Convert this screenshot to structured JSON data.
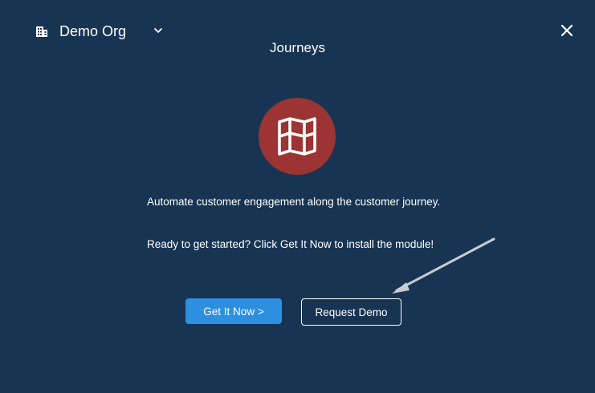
{
  "header": {
    "org_name": "Demo Org",
    "org_icon": "building-icon",
    "chevron_icon": "chevron-down-icon",
    "close_icon": "close-icon"
  },
  "module": {
    "title": "Journeys",
    "icon": "map-icon",
    "icon_bg_color": "#9b3432",
    "description": "Automate customer engagement along the customer journey.",
    "cta_text": "Ready to get started? Click Get It Now to install the module!"
  },
  "actions": {
    "primary_label": "Get It Now >",
    "secondary_label": "Request Demo",
    "primary_color": "#2d8fe0"
  },
  "theme": {
    "background": "#183453"
  }
}
